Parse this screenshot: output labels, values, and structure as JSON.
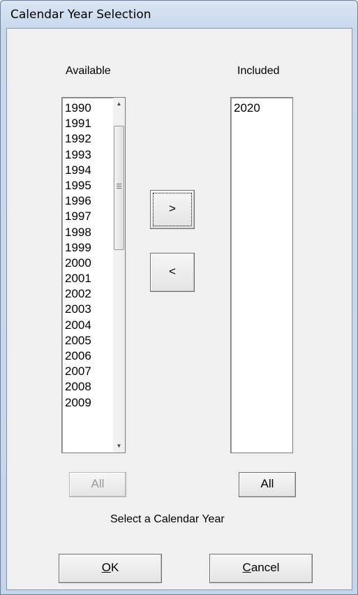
{
  "window": {
    "title": "Calendar Year Selection"
  },
  "available": {
    "label": "Available",
    "years": [
      "1990",
      "1991",
      "1992",
      "1993",
      "1994",
      "1995",
      "1996",
      "1997",
      "1998",
      "1999",
      "2000",
      "2001",
      "2002",
      "2003",
      "2004",
      "2005",
      "2006",
      "2007",
      "2008",
      "2009"
    ],
    "all_button": "All"
  },
  "included": {
    "label": "Included",
    "years": [
      "2020"
    ],
    "all_button": "All"
  },
  "move_buttons": {
    "add": ">",
    "remove": "<"
  },
  "status": "Select a Calendar Year",
  "footer": {
    "ok_prefix": "",
    "ok_hotkey": "O",
    "ok_rest": "K",
    "cancel_hotkey": "C",
    "cancel_rest": "ancel"
  }
}
